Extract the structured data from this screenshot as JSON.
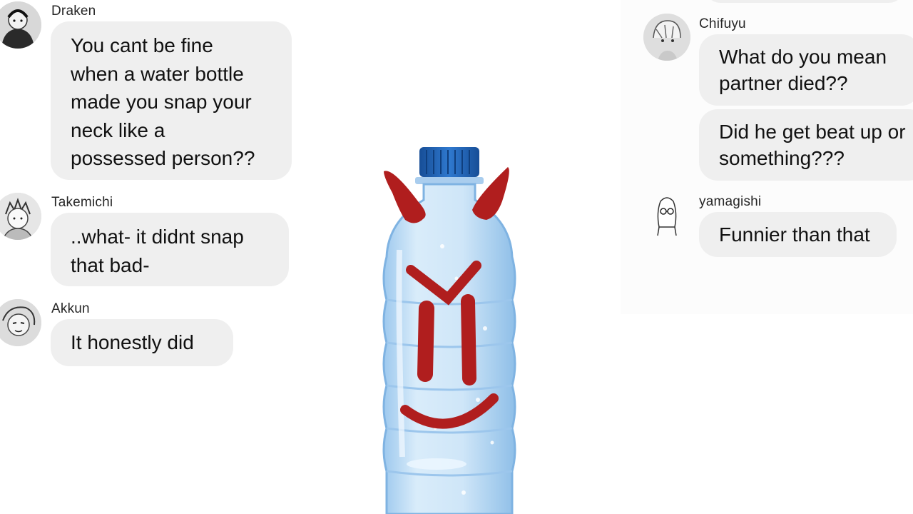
{
  "left_messages": [
    {
      "sender": "Draken",
      "avatar": "draken-avatar",
      "text": "You cant be fine\nwhen a water bottle\nmade you snap your\nneck like a\npossessed person??"
    },
    {
      "sender": "Takemichi",
      "avatar": "takemichi-avatar",
      "text": "..what- it didnt snap\nthat bad-"
    },
    {
      "sender": "Akkun",
      "avatar": "akkun-avatar",
      "text": "It honestly did"
    }
  ],
  "right_messages": [
    {
      "sender": "Chifuyu",
      "avatar": "chifuyu-avatar",
      "texts": [
        "What do you mean\npartner died??",
        "Did he get beat up or\nsomething???"
      ]
    },
    {
      "sender": "yamagishi",
      "avatar": "yamagishi-avatar",
      "texts": [
        "Funnier than that"
      ]
    }
  ],
  "colors": {
    "bubble": "#efefef",
    "cap": "#1f5fb0",
    "bottle": "#cfe6f8",
    "face": "#b01e1e"
  },
  "icons": [
    "water-bottle-illustration",
    "devil-horns",
    "angry-face"
  ]
}
